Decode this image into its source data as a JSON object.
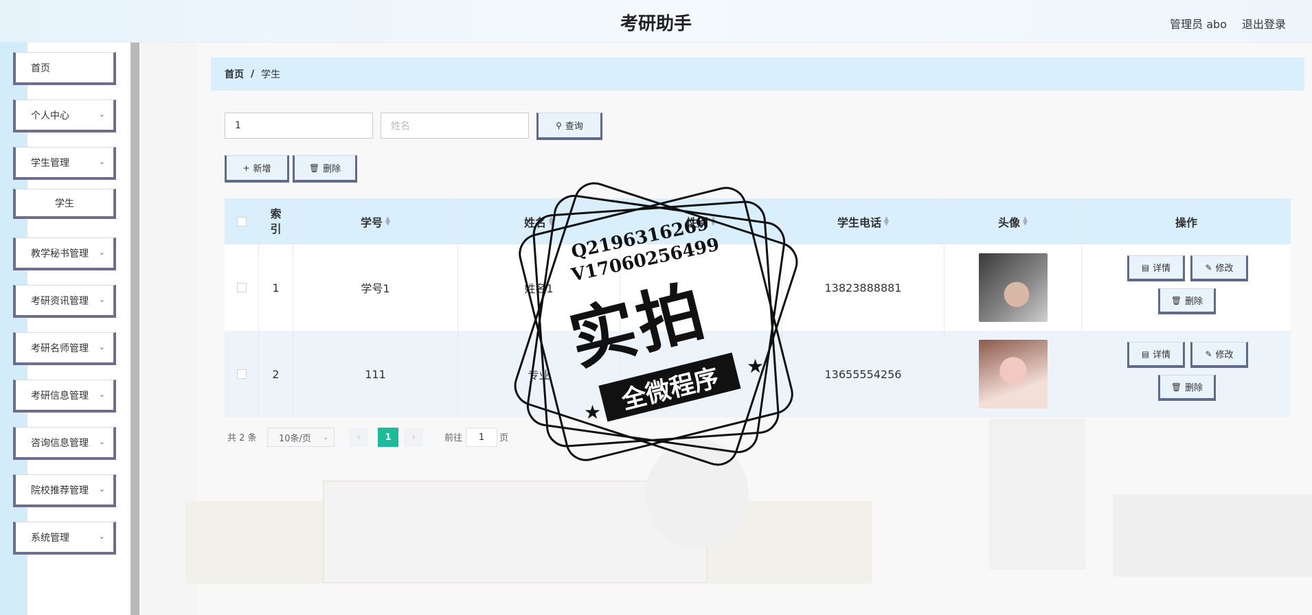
{
  "header": {
    "title": "考研助手",
    "admin_label": "管理员 abo",
    "logout_label": "退出登录"
  },
  "sidebar": {
    "items": [
      {
        "label": "首页",
        "has_chevron": false
      },
      {
        "label": "个人中心",
        "has_chevron": true
      },
      {
        "label": "学生管理",
        "has_chevron": true
      },
      {
        "label": "学生",
        "has_chevron": false,
        "submenu": true
      },
      {
        "label": "教学秘书管理",
        "has_chevron": true
      },
      {
        "label": "考研资讯管理",
        "has_chevron": true
      },
      {
        "label": "考研名师管理",
        "has_chevron": true
      },
      {
        "label": "考研信息管理",
        "has_chevron": true
      },
      {
        "label": "咨询信息管理",
        "has_chevron": true
      },
      {
        "label": "院校推荐管理",
        "has_chevron": true
      },
      {
        "label": "系统管理",
        "has_chevron": true
      }
    ]
  },
  "breadcrumb": {
    "home": "首页",
    "separator": "/",
    "current": "学生"
  },
  "search": {
    "student_no_value": "1",
    "name_placeholder": "姓名",
    "query_label": "查询"
  },
  "actions": {
    "add_label": "新增",
    "delete_label": "删除"
  },
  "table": {
    "columns": {
      "index": "索\n引",
      "student_no": "学号",
      "name": "姓名",
      "gender": "性别",
      "phone": "学生电话",
      "avatar": "头像",
      "ops": "操作"
    },
    "rows": [
      {
        "index": "1",
        "student_no": "学号1",
        "name": "姓名1",
        "gender": "",
        "phone": "13823888881"
      },
      {
        "index": "2",
        "student_no": "111",
        "name": "专业",
        "gender": "",
        "phone": "13655554256"
      }
    ],
    "row_actions": {
      "detail": "详情",
      "edit": "修改",
      "delete": "删除"
    }
  },
  "pagination": {
    "total": "共 2 条",
    "page_size": "10条/页",
    "current_page": "1",
    "goto_prefix": "前往",
    "goto_value": "1",
    "goto_suffix": "页"
  },
  "watermark": {
    "line1": "Q2196316269",
    "line2": "V17060256499",
    "big": "实拍",
    "ribbon": "全微程序"
  },
  "colors": {
    "accent": "#1abc9c",
    "header_bg": "#e6f3fb",
    "table_header_bg": "#d9effb",
    "button_border": "#5f6a8c"
  }
}
